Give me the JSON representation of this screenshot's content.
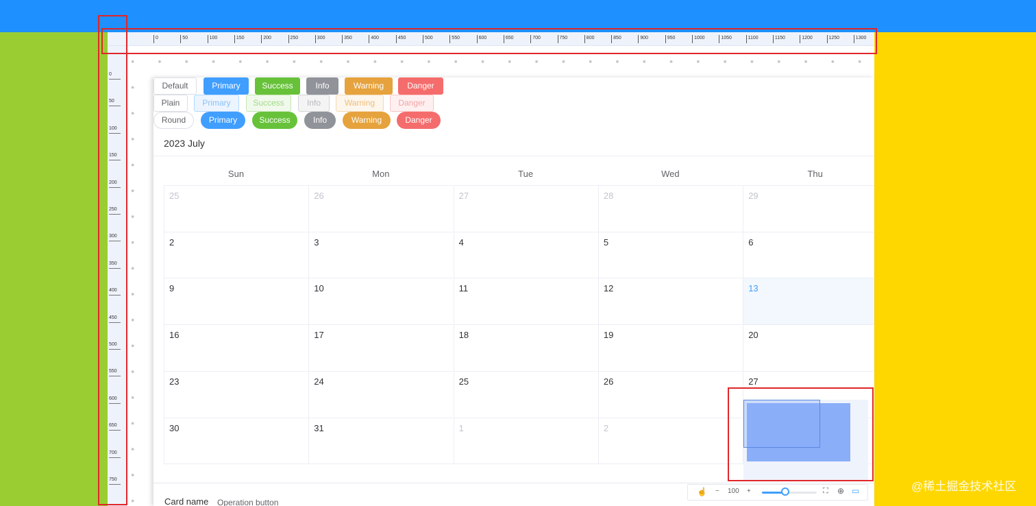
{
  "colors": {
    "top_band": "#1E90FF",
    "left_band": "#9ACD32",
    "right_band": "#FFD700",
    "highlight": "#e0262a",
    "minimap": "#8AAEF8"
  },
  "ruler": {
    "horizontal_ticks": [
      "0",
      "50",
      "100",
      "150",
      "200",
      "250",
      "300",
      "350",
      "400",
      "450",
      "500",
      "550",
      "600",
      "650",
      "700",
      "750",
      "800",
      "850",
      "900",
      "950",
      "1000",
      "1050",
      "1100",
      "1150",
      "1200",
      "1250",
      "1300"
    ],
    "vertical_ticks": [
      "0",
      "50",
      "100",
      "150",
      "200",
      "250",
      "300",
      "350",
      "400",
      "450",
      "500",
      "550",
      "600",
      "650",
      "700",
      "750"
    ]
  },
  "buttons": {
    "default_row": [
      "Default",
      "Primary",
      "Success",
      "Info",
      "Warning",
      "Danger"
    ],
    "plain_row": [
      "Plain",
      "Primary",
      "Success",
      "Info",
      "Warning",
      "Danger"
    ],
    "round_row": [
      "Round",
      "Primary",
      "Success",
      "Info",
      "Warning",
      "Danger"
    ]
  },
  "calendar": {
    "title": "2023 July",
    "weekdays": [
      "Sun",
      "Mon",
      "Tue",
      "Wed",
      "Thu"
    ],
    "weeks": [
      [
        "25",
        "26",
        "27",
        "28",
        "29"
      ],
      [
        "2",
        "3",
        "4",
        "5",
        "6"
      ],
      [
        "9",
        "10",
        "11",
        "12",
        "13"
      ],
      [
        "16",
        "17",
        "18",
        "19",
        "20"
      ],
      [
        "23",
        "24",
        "25",
        "26",
        "27"
      ],
      [
        "30",
        "31",
        "1",
        "2",
        ""
      ]
    ],
    "today": "13"
  },
  "card": {
    "name": "Card name",
    "operation": "Operation button"
  },
  "toolbar": {
    "zoom_value": "100",
    "minus": "−",
    "plus": "+"
  },
  "watermark": "@稀土掘金技术社区"
}
